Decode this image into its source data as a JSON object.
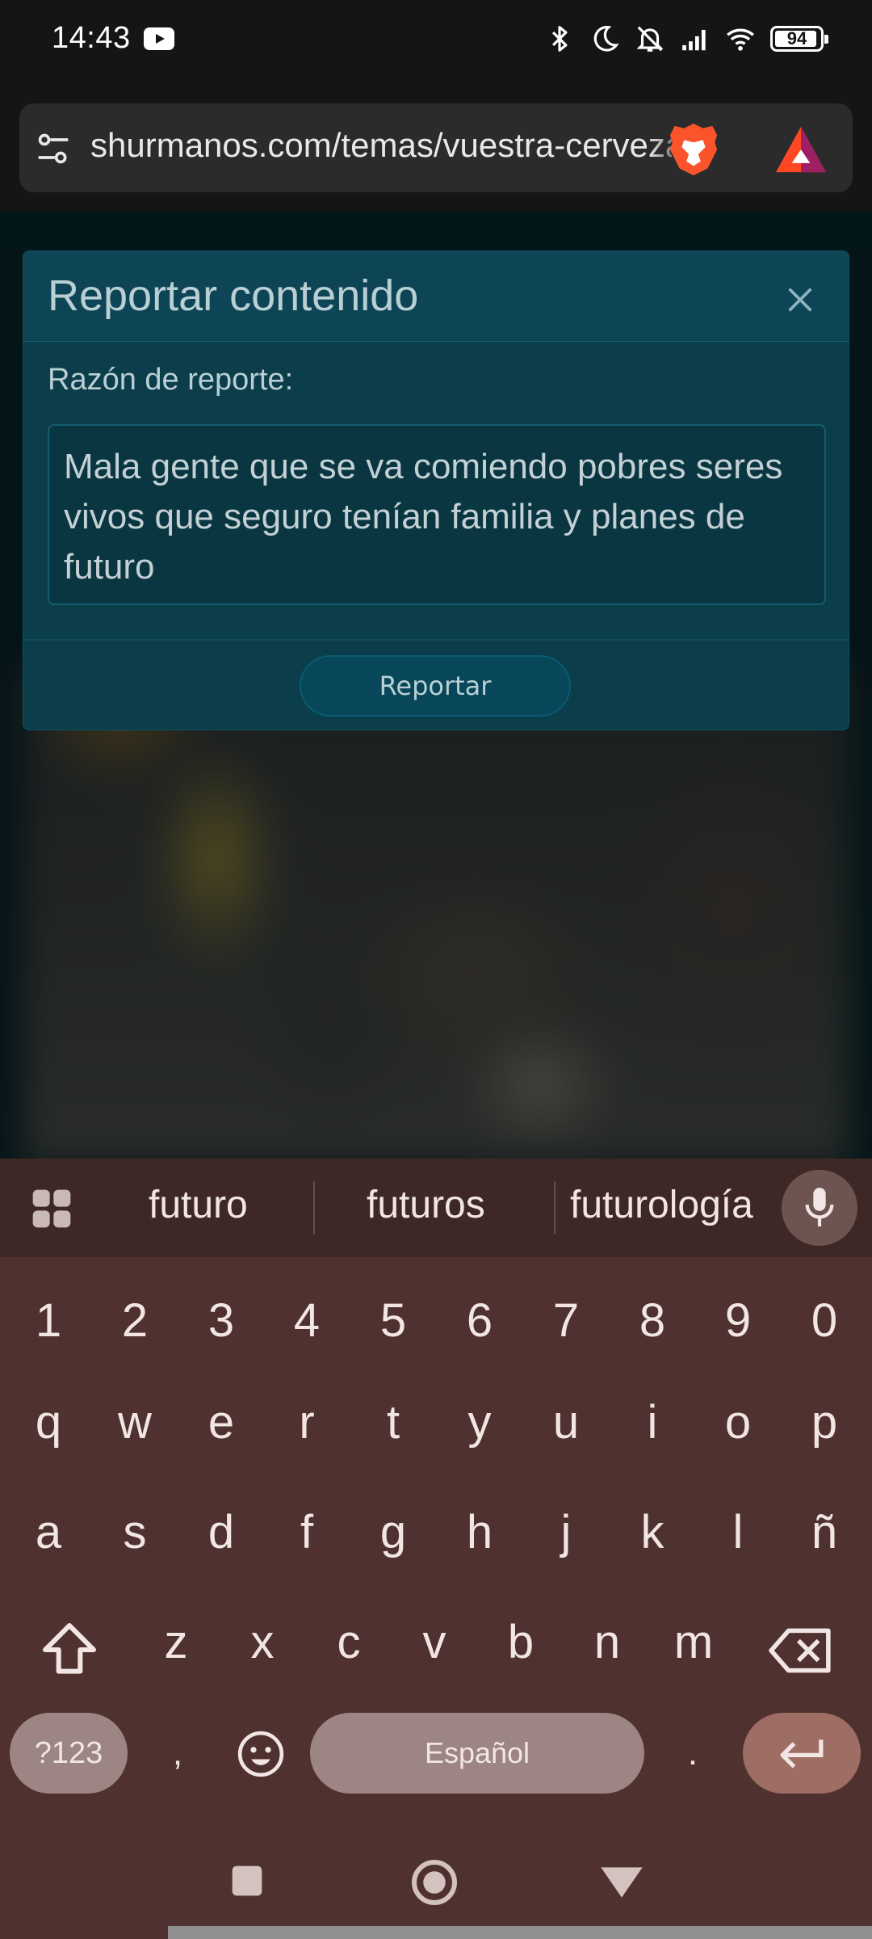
{
  "status_bar": {
    "time": "14:43",
    "notification_icons": [
      "youtube-icon"
    ],
    "system_icons": [
      "bluetooth-icon",
      "dnd-moon-icon",
      "muted-bell-icon",
      "signal-icon",
      "wifi-icon"
    ],
    "battery_level": "94"
  },
  "browser": {
    "url": "shurmanos.com/temas/vuestra-cerveza",
    "icons": [
      "site-settings-icon",
      "brave-shields-icon",
      "brave-rewards-icon"
    ]
  },
  "modal": {
    "title": "Reportar contenido",
    "reason_label": "Razón de reporte:",
    "reason_text": "Mala gente que se va comiendo pobres seres vivos que seguro tenían familia y planes de futuro",
    "submit_label": "Reportar"
  },
  "keyboard": {
    "suggestions": [
      "futuro",
      "futuros",
      "futurología"
    ],
    "number_row": [
      "1",
      "2",
      "3",
      "4",
      "5",
      "6",
      "7",
      "8",
      "9",
      "0"
    ],
    "row1": [
      "q",
      "w",
      "e",
      "r",
      "t",
      "y",
      "u",
      "i",
      "o",
      "p"
    ],
    "row2": [
      "a",
      "s",
      "d",
      "f",
      "g",
      "h",
      "j",
      "k",
      "l",
      "ñ"
    ],
    "row3": [
      "z",
      "x",
      "c",
      "v",
      "b",
      "n",
      "m"
    ],
    "symbols_label": "?123",
    "comma": ",",
    "space_label": "Español",
    "period": "."
  },
  "colors": {
    "modal_bg": "#0b3d4a",
    "keyboard_bg": "#4f3230",
    "enter_key": "#9e6d63"
  }
}
